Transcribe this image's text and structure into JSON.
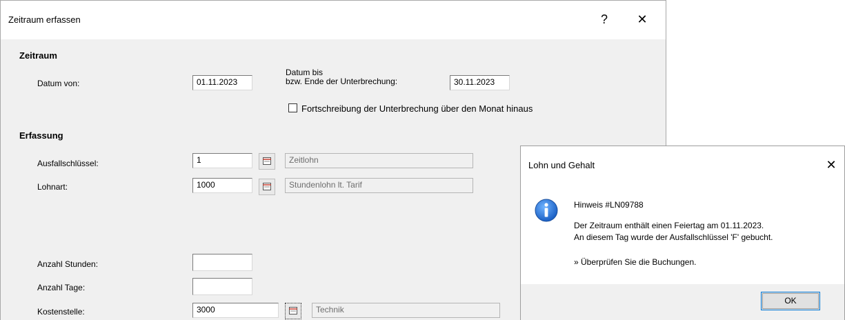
{
  "main_dialog": {
    "title": "Zeitraum erfassen",
    "help_symbol": "?",
    "close_symbol": "✕",
    "zeitraum": {
      "heading": "Zeitraum",
      "datum_von_label": "Datum von:",
      "datum_von_value": "01.11.2023",
      "datum_bis_label_line1": "Datum bis",
      "datum_bis_label_line2": "bzw. Ende der Unterbrechung:",
      "datum_bis_value": "30.11.2023",
      "fortschreibung_label": "Fortschreibung der Unterbrechung über den Monat hinaus",
      "fortschreibung_checked": false
    },
    "erfassung": {
      "heading": "Erfassung",
      "ausfallschluessel_label": "Ausfallschlüssel:",
      "ausfallschluessel_value": "1",
      "ausfallschluessel_desc": "Zeitlohn",
      "lohnart_label": "Lohnart:",
      "lohnart_value": "1000",
      "lohnart_desc": "Stundenlohn lt. Tarif",
      "anzahl_stunden_label": "Anzahl Stunden:",
      "anzahl_stunden_value": "",
      "anzahl_tage_label": "Anzahl Tage:",
      "anzahl_tage_value": "",
      "kostenstelle_label": "Kostenstelle:",
      "kostenstelle_value": "3000",
      "kostenstelle_desc": "Technik"
    }
  },
  "message_box": {
    "title": "Lohn und Gehalt",
    "close_symbol": "✕",
    "icon": "info-icon",
    "heading": "Hinweis #LN09788",
    "line1": "Der Zeitraum enthält einen Feiertag am 01.11.2023.",
    "line2": "An diesem Tag wurde der Ausfallschlüssel 'F' gebucht.",
    "line3": "» Überprüfen Sie die Buchungen.",
    "ok_label": "OK"
  },
  "colors": {
    "dialog_bg": "#f0f0f0",
    "button_focus_border": "#0078d7",
    "info_icon_blue": "#1e6fd0"
  }
}
